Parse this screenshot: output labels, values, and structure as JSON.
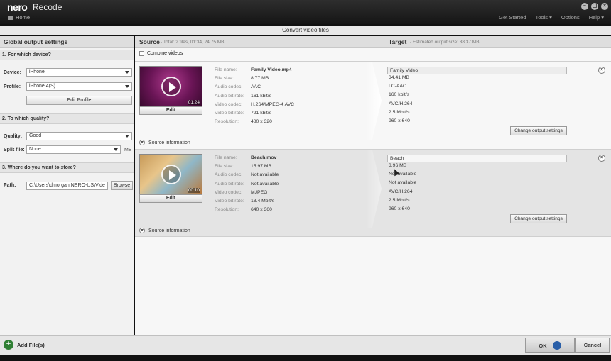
{
  "titlebar": {
    "logo": "nero",
    "app_name": "Recode",
    "home": "Home",
    "nav": [
      "Get Started",
      "Tools ▾",
      "Options",
      "Help ▾"
    ],
    "window_buttons": [
      "–",
      "▢",
      "×"
    ]
  },
  "subtitle": "Convert video files",
  "left": {
    "header": "Global output settings",
    "device_section": "1. For which device?",
    "device_label": "Device:",
    "device_value": "iPhone",
    "profile_label": "Profile:",
    "profile_value": "iPhone 4(S)",
    "edit_profile": "Edit Profile",
    "quality_section": "2. To which quality?",
    "quality_label": "Quality:",
    "quality_value": "Good",
    "split_label": "Split file:",
    "split_value": "None",
    "split_unit": "MB",
    "store_section": "3. Where do you want to store?",
    "path_label": "Path:",
    "path_value": "C:\\Users\\dmorgan.NERO-US\\Vide",
    "browse": "Browse"
  },
  "source_header": {
    "title": "Source",
    "meta": "- Total: 2 files, 01:34, 24.75 MB",
    "target_title": "Target",
    "target_meta": "- Estimated output size: 38.37 MB",
    "combine": "Combine videos"
  },
  "prop_labels": [
    "File name:",
    "File size:",
    "Audio codec:",
    "Audio bit rate:",
    "Video codec:",
    "Video bit rate:",
    "Resolution:"
  ],
  "items": [
    {
      "duration": "01:24",
      "edit": "Edit",
      "source": [
        "Family Video.mp4",
        "8.77 MB",
        "AAC",
        "161 kbit/s",
        "H.264/MPEG-4 AVC",
        "721 kbit/s",
        "480 x 320"
      ],
      "target_name": "Family Video",
      "target": [
        "34.41 MB",
        "LC-AAC",
        "160 kbit/s",
        "AVC/H.264",
        "2.5 Mbit/s",
        "960 x 640"
      ],
      "change": "Change output settings",
      "source_info": "Source information"
    },
    {
      "duration": "00:10",
      "edit": "Edit",
      "source": [
        "Beach.mov",
        "15.97 MB",
        "Not available",
        "Not available",
        "MJPEG",
        "13.4 Mbit/s",
        "640 x 360"
      ],
      "target_name": "Beach",
      "target": [
        "3.96 MB",
        "Not available",
        "Not available",
        "AVC/H.264",
        "2.5 Mbit/s",
        "960 x 640"
      ],
      "change": "Change output settings",
      "source_info": "Source information"
    }
  ],
  "bottom": {
    "add_files": "Add File(s)",
    "ok": "OK",
    "cancel": "Cancel"
  },
  "colors": {
    "titlebar": "#1a1a1a",
    "panel": "#f2f2f2",
    "add_icon": "#2f7f34",
    "ok_icon": "#2a5fa8"
  }
}
